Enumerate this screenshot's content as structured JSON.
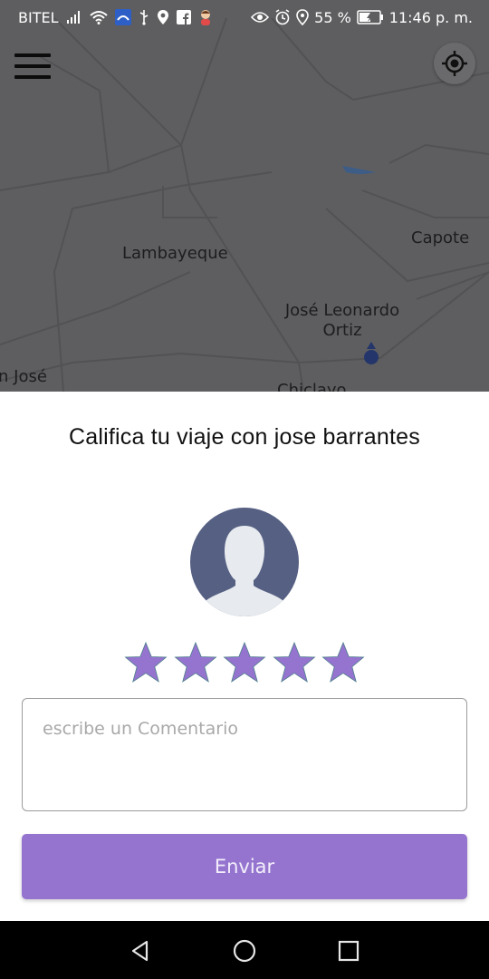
{
  "status_bar": {
    "carrier": "BITEL",
    "battery_percent": "55 %",
    "time": "11:46 p. m.",
    "icons_left": [
      "signal-icon",
      "wifi-icon",
      "app-notification-icon",
      "usb-icon",
      "location-icon",
      "facebook-icon",
      "avatar-notification-icon"
    ],
    "icons_right": [
      "eye-icon",
      "alarm-icon",
      "location-icon",
      "battery-charging-icon"
    ]
  },
  "map": {
    "labels": {
      "lambayeque": "Lambayeque",
      "capote": "Capote",
      "jose_leonardo": "José Leonardo Ortiz",
      "san_jose": "n José",
      "chiclayo": "Chiclayo"
    }
  },
  "rating": {
    "title": "Califica tu viaje con jose barrantes",
    "rating_value": 5,
    "max_rating": 5,
    "comment_placeholder": "escribe un Comentario",
    "comment_value": "",
    "submit_label": "Enviar"
  },
  "colors": {
    "accent": "#9574cf",
    "star": "#9574cf",
    "avatar_bg": "#566083",
    "map_bg": "#5e5e60"
  },
  "navigation": {
    "buttons": [
      "back-icon",
      "home-icon",
      "recents-icon"
    ]
  }
}
